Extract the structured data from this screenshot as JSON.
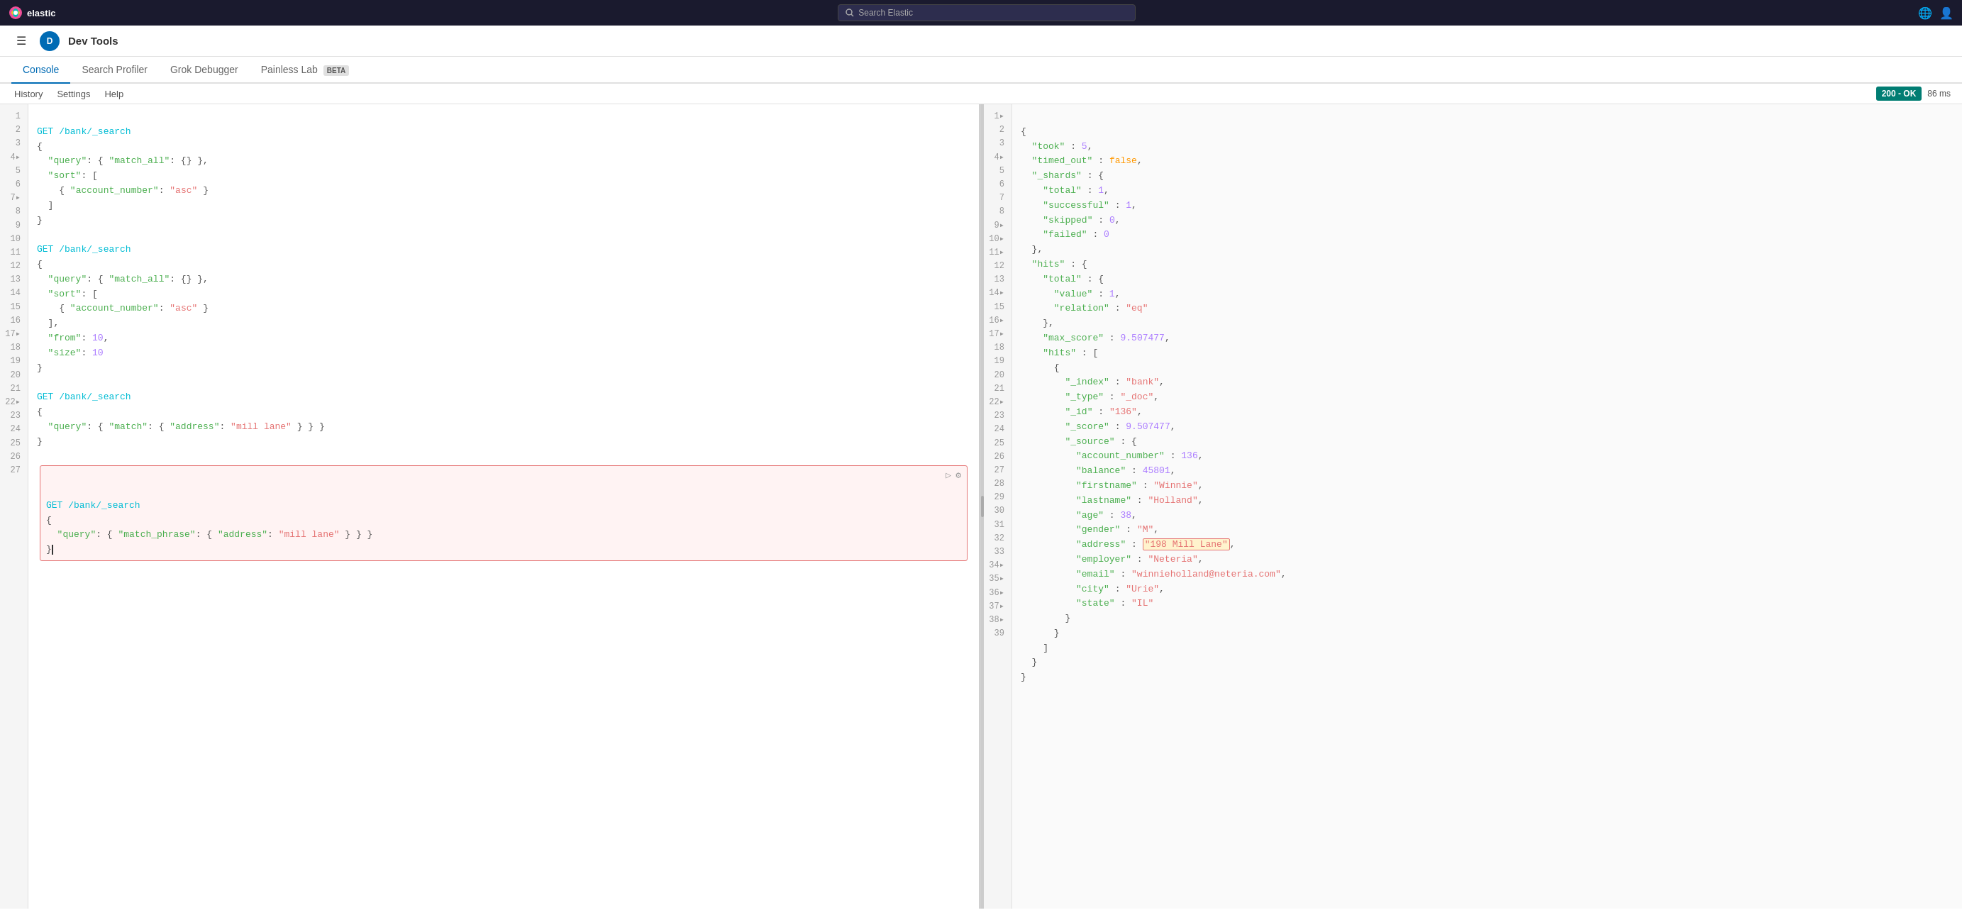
{
  "topbar": {
    "logo_text": "elastic",
    "search_placeholder": "Search Elastic",
    "app_title": "Dev Tools",
    "user_initial": "D"
  },
  "tabs": [
    {
      "id": "console",
      "label": "Console",
      "active": true
    },
    {
      "id": "search-profiler",
      "label": "Search Profiler",
      "active": false
    },
    {
      "id": "grok-debugger",
      "label": "Grok Debugger",
      "active": false
    },
    {
      "id": "painless-lab",
      "label": "Painless Lab",
      "active": false,
      "badge": "BETA"
    }
  ],
  "toolbar": {
    "history_label": "History",
    "settings_label": "Settings",
    "help_label": "Help"
  },
  "status": {
    "code": "200 - OK",
    "time": "86 ms"
  },
  "editor": {
    "lines": [
      {
        "num": 1,
        "text": "GET /bank/_search",
        "type": "method"
      },
      {
        "num": 2,
        "text": "{",
        "type": "punc"
      },
      {
        "num": 3,
        "text": "  \"query\": { \"match_all\": {} },",
        "type": "code"
      },
      {
        "num": 4,
        "text": "  \"sort\": [",
        "type": "code"
      },
      {
        "num": 5,
        "text": "    { \"account_number\": \"asc\" }",
        "type": "code"
      },
      {
        "num": 6,
        "text": "  ]",
        "type": "code"
      },
      {
        "num": 7,
        "text": "}",
        "type": "punc"
      },
      {
        "num": 8,
        "text": "",
        "type": "empty"
      },
      {
        "num": 9,
        "text": "GET /bank/_search",
        "type": "method"
      },
      {
        "num": 10,
        "text": "{",
        "type": "punc"
      },
      {
        "num": 11,
        "text": "  \"query\": { \"match_all\": {} },",
        "type": "code"
      },
      {
        "num": 12,
        "text": "  \"sort\": [",
        "type": "code"
      },
      {
        "num": 13,
        "text": "    { \"account_number\": \"asc\" }",
        "type": "code"
      },
      {
        "num": 14,
        "text": "  ],",
        "type": "code"
      },
      {
        "num": 15,
        "text": "  \"from\": 10,",
        "type": "code"
      },
      {
        "num": 16,
        "text": "  \"size\": 10",
        "type": "code"
      },
      {
        "num": 17,
        "text": "}",
        "type": "punc"
      },
      {
        "num": 18,
        "text": "",
        "type": "empty"
      },
      {
        "num": 19,
        "text": "GET /bank/_search",
        "type": "method"
      },
      {
        "num": 20,
        "text": "{",
        "type": "punc"
      },
      {
        "num": 21,
        "text": "  \"query\": { \"match\": { \"address\": \"mill lane\" } }",
        "type": "code"
      },
      {
        "num": 22,
        "text": "}",
        "type": "punc"
      },
      {
        "num": 23,
        "text": "",
        "type": "empty"
      },
      {
        "num": 24,
        "text": "GET /bank/_search",
        "type": "method",
        "active": true
      },
      {
        "num": 25,
        "text": "{",
        "type": "punc",
        "active": true
      },
      {
        "num": 26,
        "text": "  \"query\": { \"match_phrase\": { \"address\": \"mill lane\" } }",
        "type": "code",
        "active": true
      },
      {
        "num": 27,
        "text": "}",
        "type": "punc",
        "active": true
      }
    ]
  },
  "result": {
    "lines": [
      {
        "num": 1,
        "text": "{",
        "collapse": true
      },
      {
        "num": 2,
        "text": "  \"took\" : 5,"
      },
      {
        "num": 3,
        "text": "  \"timed_out\" : false,"
      },
      {
        "num": 4,
        "text": "  \"_shards\" : {",
        "collapse": true
      },
      {
        "num": 5,
        "text": "    \"total\" : 1,"
      },
      {
        "num": 6,
        "text": "    \"successful\" : 1,"
      },
      {
        "num": 7,
        "text": "    \"skipped\" : 0,"
      },
      {
        "num": 8,
        "text": "    \"failed\" : 0"
      },
      {
        "num": 9,
        "text": "  },",
        "collapse": true
      },
      {
        "num": 10,
        "text": "  \"hits\" : {",
        "collapse": true
      },
      {
        "num": 11,
        "text": "    \"total\" : {",
        "collapse": true
      },
      {
        "num": 12,
        "text": "      \"value\" : 1,"
      },
      {
        "num": 13,
        "text": "      \"relation\" : \"eq\""
      },
      {
        "num": 14,
        "text": "    },",
        "collapse": true
      },
      {
        "num": 15,
        "text": "    \"max_score\" : 9.507477,"
      },
      {
        "num": 16,
        "text": "    \"hits\" : [",
        "collapse": true
      },
      {
        "num": 17,
        "text": "      {",
        "collapse": true
      },
      {
        "num": 18,
        "text": "        \"_index\" : \"bank\","
      },
      {
        "num": 19,
        "text": "        \"_type\" : \"_doc\","
      },
      {
        "num": 20,
        "text": "        \"_id\" : \"136\","
      },
      {
        "num": 21,
        "text": "        \"_score\" : 9.507477,"
      },
      {
        "num": 22,
        "text": "        \"_source\" : {",
        "collapse": true
      },
      {
        "num": 23,
        "text": "          \"account_number\" : 136,"
      },
      {
        "num": 24,
        "text": "          \"balance\" : 45801,"
      },
      {
        "num": 25,
        "text": "          \"firstname\" : \"Winnie\","
      },
      {
        "num": 26,
        "text": "          \"lastname\" : \"Holland\","
      },
      {
        "num": 27,
        "text": "          \"age\" : 38,"
      },
      {
        "num": 28,
        "text": "          \"gender\" : \"M\","
      },
      {
        "num": 29,
        "text": "          \"address\" : \"198 Mill Lane\"",
        "highlight": true
      },
      {
        "num": 30,
        "text": "          \"employer\" : \"Neteria\","
      },
      {
        "num": 31,
        "text": "          \"email\" : \"winnieholland@neteria.com\","
      },
      {
        "num": 32,
        "text": "          \"city\" : \"Urie\","
      },
      {
        "num": 33,
        "text": "          \"state\" : \"IL\""
      },
      {
        "num": 34,
        "text": "        }",
        "collapse": true
      },
      {
        "num": 35,
        "text": "      }",
        "collapse": true
      },
      {
        "num": 36,
        "text": "    ]",
        "collapse": true
      },
      {
        "num": 37,
        "text": "  }",
        "collapse": true
      },
      {
        "num": 38,
        "text": "}",
        "collapse": true
      },
      {
        "num": 39,
        "text": ""
      }
    ]
  }
}
